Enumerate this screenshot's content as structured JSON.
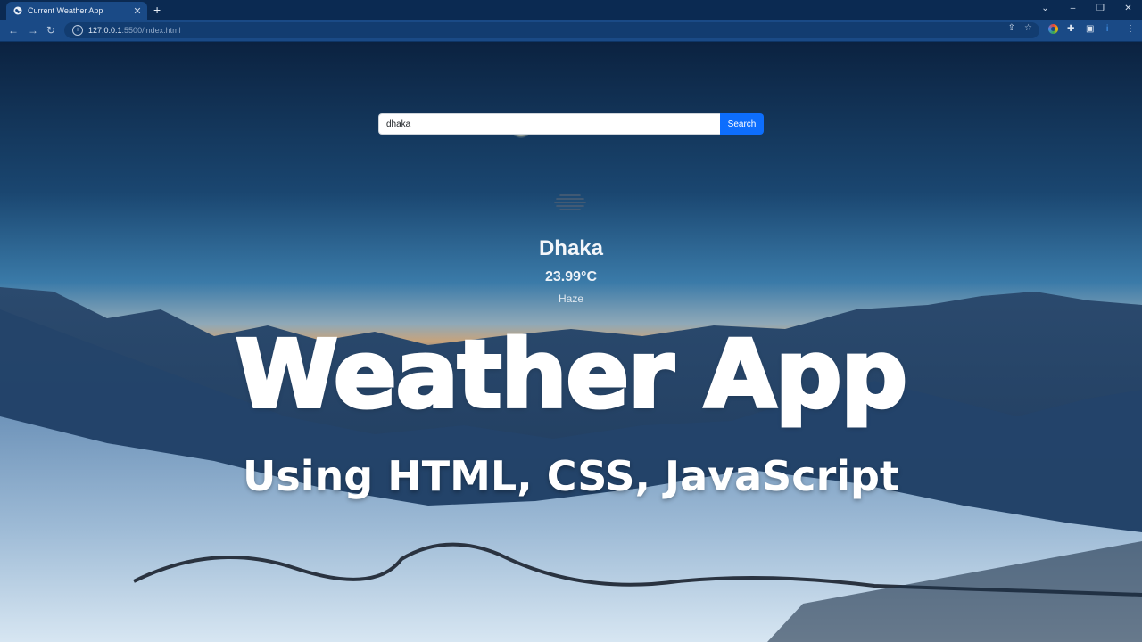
{
  "browser": {
    "tab_title": "Current Weather App",
    "new_tab_label": "+",
    "url_host": "127.0.0.1",
    "url_path": ":5500/index.html",
    "window_controls": {
      "dropdown": "⌄",
      "minimize": "–",
      "restore": "❐",
      "close": "✕"
    }
  },
  "search": {
    "value": "dhaka",
    "button_label": "Search"
  },
  "weather": {
    "icon": "haze-icon",
    "city": "Dhaka",
    "temperature": "23.99°C",
    "description": "Haze"
  },
  "overlay": {
    "title": "Weather App",
    "subtitle": "Using HTML, CSS, JavaScript"
  }
}
